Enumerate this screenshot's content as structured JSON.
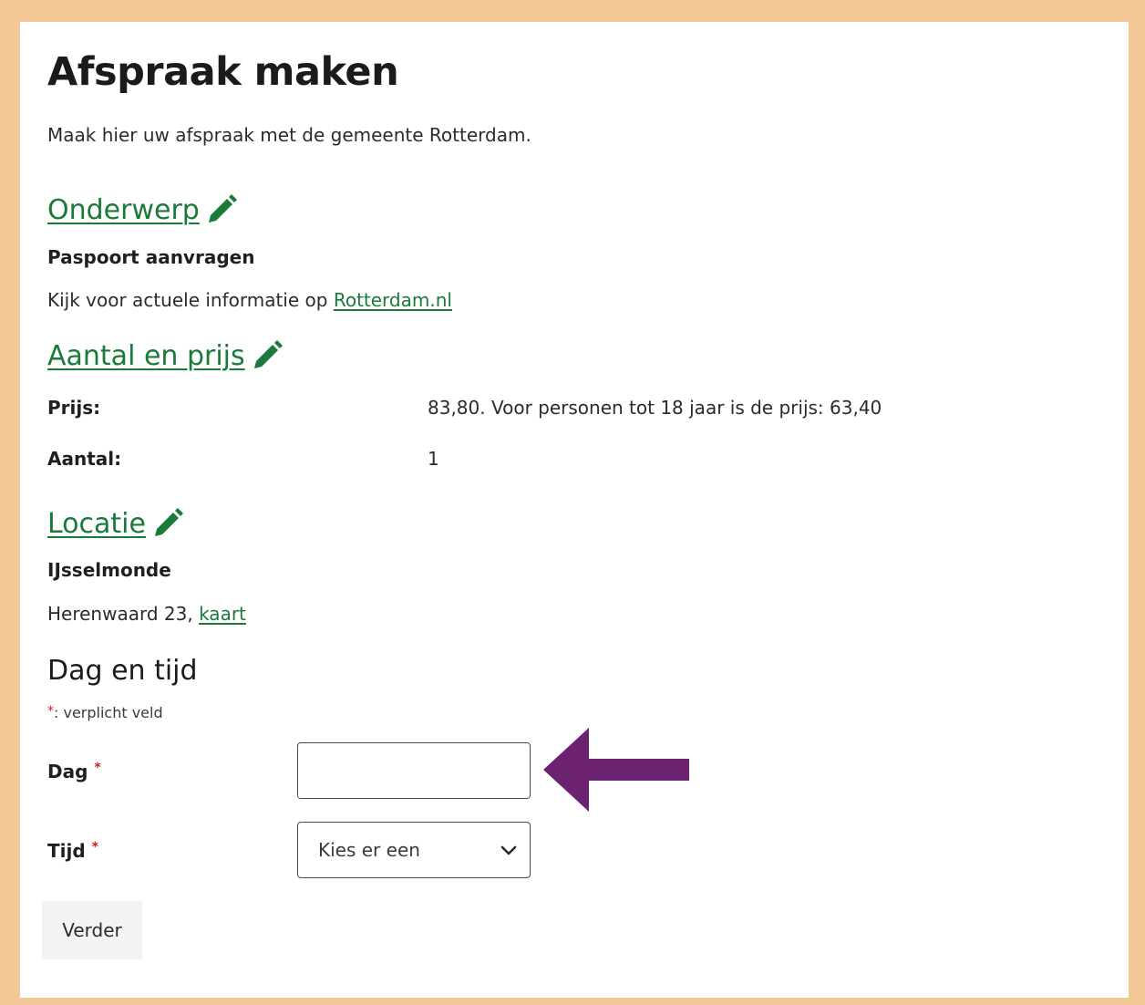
{
  "page": {
    "title": "Afspraak maken",
    "intro": "Maak hier uw afspraak met de gemeente Rotterdam."
  },
  "onderwerp": {
    "heading": "Onderwerp",
    "value": "Paspoort aanvragen",
    "info_prefix": "Kijk voor actuele informatie op",
    "info_link": "Rotterdam.nl"
  },
  "aantal_prijs": {
    "heading": "Aantal en prijs",
    "price_label": "Prijs:",
    "price_value": "83,80. Voor personen tot 18 jaar is de prijs: 63,40",
    "count_label": "Aantal:",
    "count_value": "1"
  },
  "locatie": {
    "heading": "Locatie",
    "name": "IJsselmonde",
    "address": "Herenwaard 23,",
    "map_link": "kaart"
  },
  "dag_tijd": {
    "heading": "Dag en tijd",
    "required_marker": "*",
    "required_note": ": verplicht veld",
    "day_label": "Dag",
    "day_value": "",
    "time_label": "Tijd",
    "time_selected": "Kies er een"
  },
  "buttons": {
    "next": "Verder"
  },
  "icons": [
    "pencil-icon",
    "calendar-icon",
    "chevron-down-icon",
    "arrow-left-icon"
  ],
  "colors": {
    "border_frame": "#f4c896",
    "link_green": "#197a3a",
    "arrow_purple": "#6b2270",
    "required_red": "#d11a2a"
  }
}
